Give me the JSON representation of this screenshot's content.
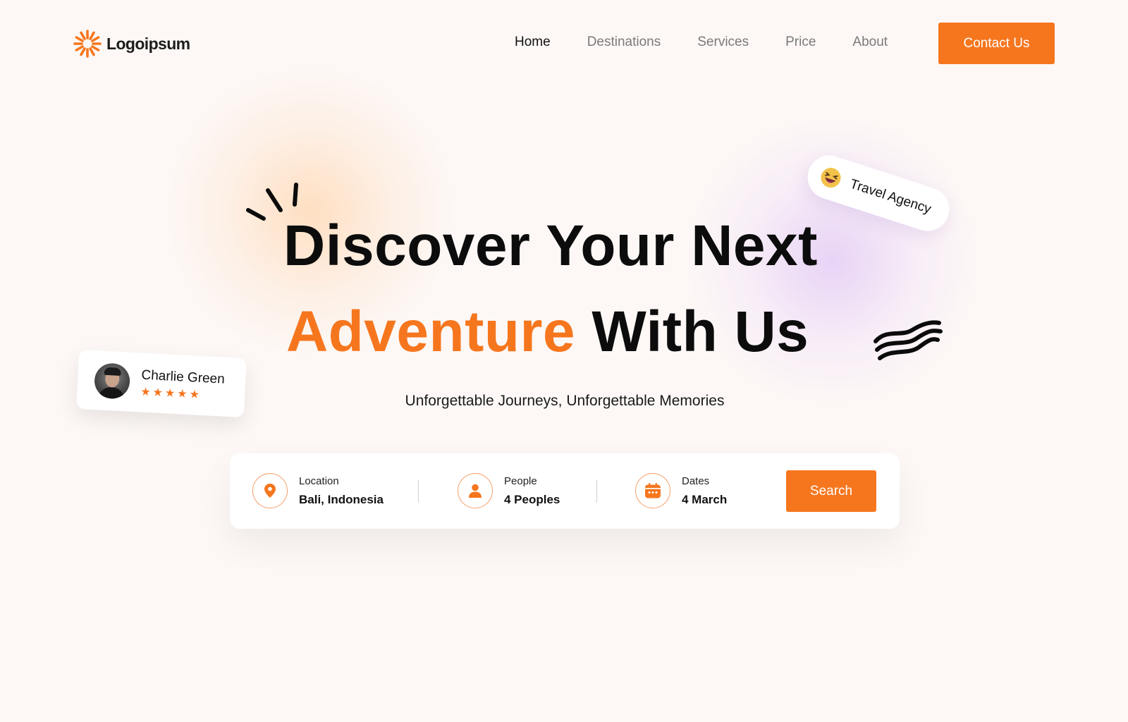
{
  "colors": {
    "accent": "#f6761e",
    "background": "#fdf8f6",
    "text": "#111111"
  },
  "brand": {
    "name": "Logoipsum",
    "icon": "sunburst-logo-icon"
  },
  "nav": {
    "items": [
      {
        "label": "Home",
        "active": true
      },
      {
        "label": "Destinations",
        "active": false
      },
      {
        "label": "Services",
        "active": false
      },
      {
        "label": "Price",
        "active": false
      },
      {
        "label": "About",
        "active": false
      }
    ],
    "cta_label": "Contact Us"
  },
  "hero": {
    "line1": "Discover Your Next",
    "line2_accent": "Adventure",
    "line2_rest": "With Us",
    "subtitle": "Unforgettable Journeys, Unforgettable Memories"
  },
  "badge": {
    "label": "Travel Agency",
    "icon": "laughing-face-emoji-icon"
  },
  "review": {
    "name": "Charlie Green",
    "rating": 5,
    "stars": [
      "★",
      "★",
      "★",
      "★",
      "★"
    ]
  },
  "search": {
    "location": {
      "label": "Location",
      "value": "Bali, Indonesia",
      "icon": "location-pin-icon"
    },
    "people": {
      "label": "People",
      "value": "4 Peoples",
      "icon": "person-icon"
    },
    "dates": {
      "label": "Dates",
      "value": "4 March",
      "icon": "calendar-icon"
    },
    "button_label": "Search"
  }
}
